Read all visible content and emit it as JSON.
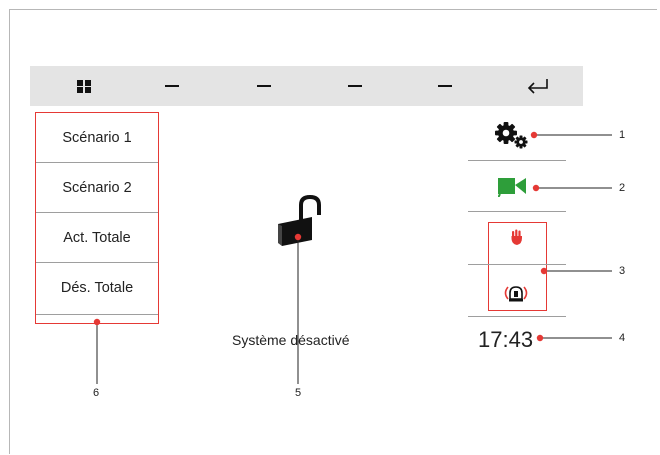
{
  "scenarios": [
    "Scénario 1",
    "Scénario 2",
    "Act. Totale",
    "Dés. Totale"
  ],
  "status": "Système désactivé",
  "time": "17:43",
  "callouts": [
    "1",
    "2",
    "3",
    "4",
    "5",
    "6"
  ],
  "icons": {
    "menu": "grid-icon",
    "back": "return-arrow-icon",
    "settings": "gears-icon",
    "camera": "video-camera-icon",
    "hand": "hand-stop-icon",
    "alarm": "siren-icon",
    "lock": "padlock-open-icon"
  },
  "colors": {
    "accent": "#e53935",
    "camera": "#2e9e3a",
    "bar": "#e4e4e4"
  }
}
